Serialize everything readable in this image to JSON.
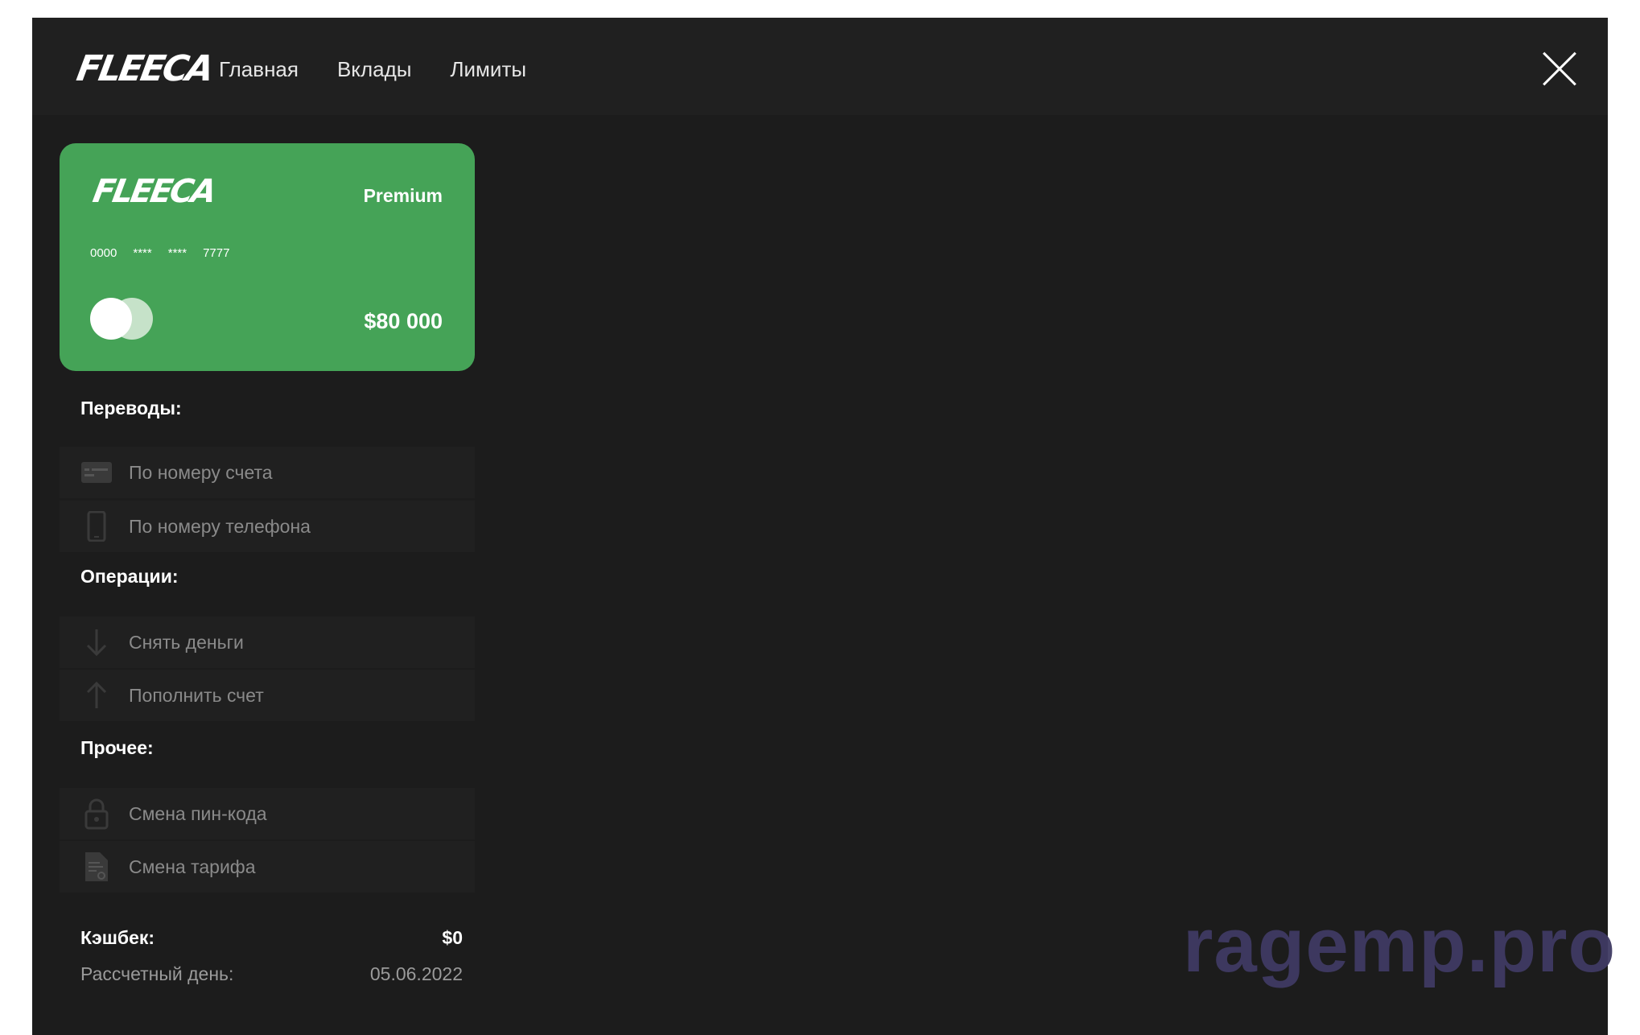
{
  "brand": {
    "logo_text": "FLEECA"
  },
  "nav": {
    "items": [
      {
        "label": "Главная"
      },
      {
        "label": "Вклады"
      },
      {
        "label": "Лимиты"
      }
    ]
  },
  "card": {
    "logo_text": "FLEECA",
    "tier": "Premium",
    "number_groups": [
      "0000",
      "****",
      "****",
      "7777"
    ],
    "balance": "$80 000",
    "color": "#45a357"
  },
  "sections": {
    "transfers": {
      "title": "Переводы:",
      "items": [
        {
          "label": "По номеру счета",
          "icon": "card-icon"
        },
        {
          "label": "По номеру телефона",
          "icon": "phone-icon"
        }
      ]
    },
    "operations": {
      "title": "Операции:",
      "items": [
        {
          "label": "Снять деньги",
          "icon": "arrow-down-icon"
        },
        {
          "label": "Пополнить счет",
          "icon": "arrow-up-icon"
        }
      ]
    },
    "other": {
      "title": "Прочее:",
      "items": [
        {
          "label": "Смена пин-кода",
          "icon": "lock-icon"
        },
        {
          "label": "Смена тарифа",
          "icon": "document-icon"
        }
      ]
    }
  },
  "summary": {
    "cashback_label": "Кэшбек:",
    "cashback_value": "$0",
    "billing_day_label": "Рассчетный день:",
    "billing_day_value": "05.06.2022"
  },
  "watermark": "ragemp.pro"
}
